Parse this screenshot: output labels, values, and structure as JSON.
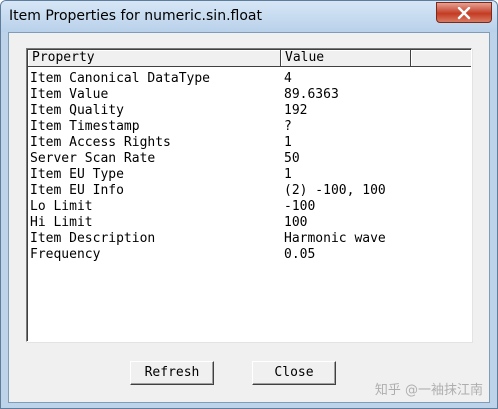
{
  "window": {
    "title": "Item Properties for numeric.sin.float"
  },
  "table": {
    "columns": [
      "Property",
      "Value"
    ],
    "rows": [
      {
        "property": "Item Canonical DataType",
        "value": "4"
      },
      {
        "property": "Item Value",
        "value": "89.6363"
      },
      {
        "property": "Item Quality",
        "value": "192"
      },
      {
        "property": "Item Timestamp",
        "value": "?"
      },
      {
        "property": "Item Access Rights",
        "value": "1"
      },
      {
        "property": "Server Scan Rate",
        "value": "50"
      },
      {
        "property": "Item EU Type",
        "value": "1"
      },
      {
        "property": "Item EU Info",
        "value": "(2) -100, 100"
      },
      {
        "property": "Lo Limit",
        "value": "-100"
      },
      {
        "property": "Hi Limit",
        "value": "100"
      },
      {
        "property": "Item Description",
        "value": "Harmonic wave"
      },
      {
        "property": "Frequency",
        "value": "0.05"
      }
    ]
  },
  "buttons": {
    "refresh": "Refresh",
    "close": "Close"
  },
  "watermark": "知乎 @一袖抹江南",
  "icons": {
    "close": "close-icon"
  },
  "colors": {
    "close_button": "#c53b22",
    "frame": "#bcd3ea"
  }
}
